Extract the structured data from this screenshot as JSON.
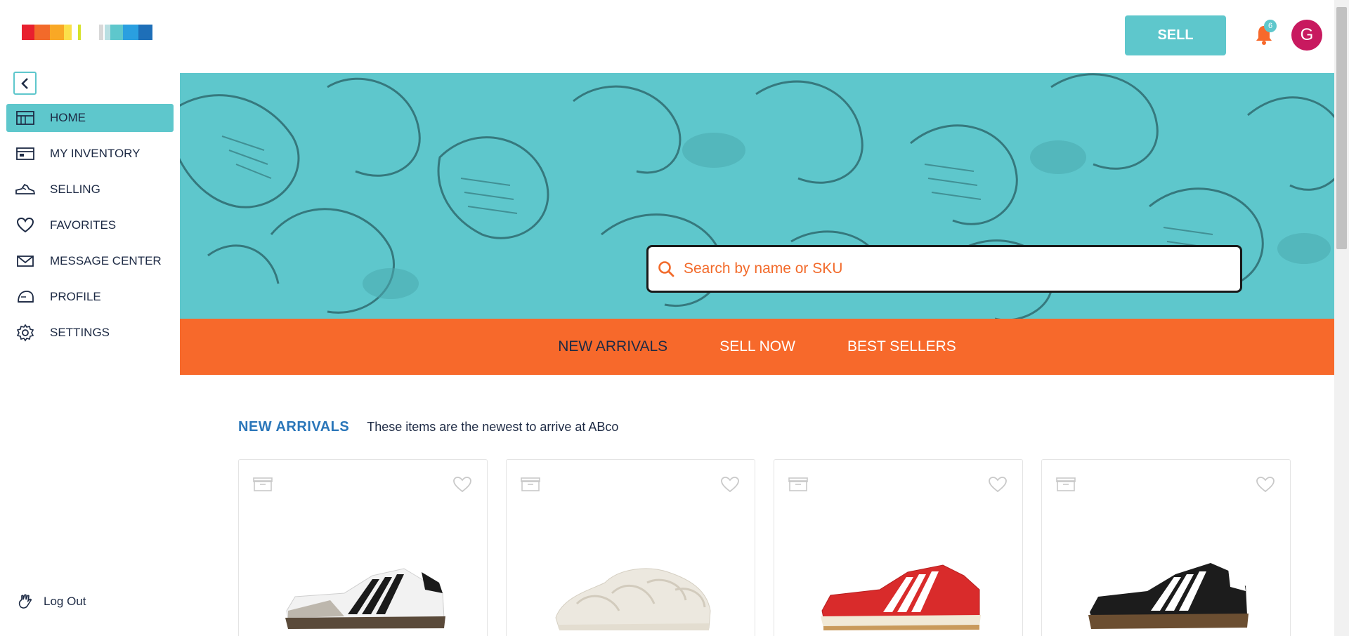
{
  "brand": {
    "colors": [
      "#e8202f",
      "#f26a2a",
      "#f9a825",
      "#fbe04a",
      "#d8d8d8",
      "#c8c8c8",
      "#5ec7cc",
      "#34b6d6",
      "#2a9fe0",
      "#1e6fb8"
    ]
  },
  "header": {
    "sell_label": "SELL",
    "notification_count": "6",
    "avatar_initial": "G"
  },
  "sidebar": {
    "items": [
      {
        "label": "HOME",
        "icon": "home-grid-icon",
        "active": true
      },
      {
        "label": "MY INVENTORY",
        "icon": "inventory-icon",
        "active": false
      },
      {
        "label": "SELLING",
        "icon": "sneaker-icon",
        "active": false
      },
      {
        "label": "FAVORITES",
        "icon": "heart-icon",
        "active": false
      },
      {
        "label": "MESSAGE CENTER",
        "icon": "envelope-icon",
        "active": false
      },
      {
        "label": "PROFILE",
        "icon": "profile-icon",
        "active": false
      },
      {
        "label": "SETTINGS",
        "icon": "gear-icon",
        "active": false
      }
    ],
    "logout_label": "Log Out"
  },
  "hero": {
    "search_placeholder": "Search by name or SKU"
  },
  "promo_nav": {
    "items": [
      "NEW ARRIVALS",
      "SELL NOW",
      "BEST SELLERS"
    ]
  },
  "section": {
    "title": "NEW ARRIVALS",
    "subtitle": "These items are the newest to arrive at ABco"
  },
  "products": [
    {
      "shoe": "white-black-stripe-sneaker",
      "color": "#f2f2f2",
      "stripe": "#1a1a1a",
      "sole": "#5a4a3a"
    },
    {
      "shoe": "cream-knit-sneaker",
      "color": "#ece8df",
      "stripe": "#ddd7cb",
      "sole": "#e8e3d8"
    },
    {
      "shoe": "red-white-stripe-sneaker",
      "color": "#d92b2b",
      "stripe": "#ffffff",
      "sole": "#f1e9d6"
    },
    {
      "shoe": "black-white-stripe-sneaker",
      "color": "#1c1c1c",
      "stripe": "#ffffff",
      "sole": "#6b4e31"
    }
  ],
  "theme": {
    "accent": "#5ec7cc",
    "promo": "#f7692b",
    "title_blue": "#2a76b9",
    "avatar": "#c8195f"
  }
}
